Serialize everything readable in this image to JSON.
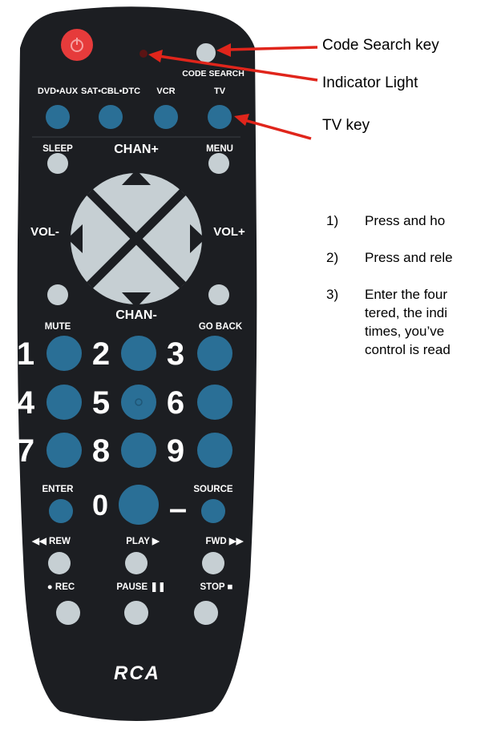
{
  "remote": {
    "labels": {
      "code_search": "CODE SEARCH",
      "dvd_aux": "DVD•AUX",
      "sat_cbl_dtc": "SAT•CBL•DTC",
      "vcr": "VCR",
      "tv": "TV",
      "sleep": "SLEEP",
      "chan_plus": "CHAN+",
      "menu": "MENU",
      "vol_minus": "VOL-",
      "vol_plus": "VOL+",
      "chan_minus": "CHAN-",
      "mute": "MUTE",
      "go_back": "GO BACK",
      "enter": "ENTER",
      "source": "SOURCE",
      "rew": "◀◀ REW",
      "play": "PLAY ▶",
      "fwd": "FWD ▶▶",
      "rec": "● REC",
      "pause": "PAUSE ❚❚",
      "stop": "STOP ■",
      "brand": "RCA",
      "digits": [
        "1",
        "2",
        "3",
        "4",
        "5",
        "6",
        "7",
        "8",
        "9",
        "0"
      ],
      "dash": "–"
    },
    "colors": {
      "body": "#1c1e22",
      "blue_key": "#2a6f96",
      "gray_key": "#c6cfd3",
      "power_key": "#e63b3b",
      "arrow": "#e0251b"
    }
  },
  "callouts": {
    "code_search_key": "Code Search key",
    "indicator_light": "Indicator Light",
    "tv_key": "TV key"
  },
  "steps": [
    {
      "num": "1)",
      "text": "Press and ho"
    },
    {
      "num": "2)",
      "text": "Press and rele"
    },
    {
      "num": "3)",
      "text": "Enter the four",
      "lines": [
        "tered, the indi",
        "times, you’ve",
        "control is read"
      ]
    }
  ]
}
